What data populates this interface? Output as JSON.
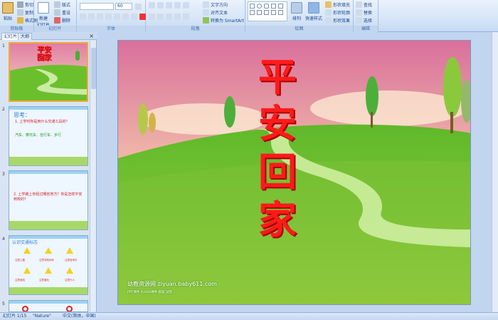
{
  "ribbon": {
    "clipboard": {
      "label": "剪贴板",
      "paste": "粘贴",
      "cut": "剪切",
      "copy": "复制",
      "format_painter": "格式刷"
    },
    "slides": {
      "label": "幻灯片",
      "new_slide": "新建\n幻灯片",
      "layout": "版式",
      "reset": "重设",
      "delete": "删除"
    },
    "font": {
      "label": "字体",
      "font_size": "60"
    },
    "paragraph": {
      "label": "段落",
      "text_direction": "文字方向",
      "align_text": "对齐文本",
      "smartart": "转换为 SmartArt"
    },
    "drawing": {
      "label": "绘图",
      "arrange": "排列",
      "quick_styles": "快速样式",
      "shape_fill": "形状填充",
      "shape_outline": "形状轮廓",
      "shape_effects": "形状效果"
    },
    "editing": {
      "label": "编辑",
      "find": "查找",
      "replace": "替换",
      "select": "选择"
    }
  },
  "panel": {
    "tab_slides": "幻灯片",
    "tab_outline": "大纲",
    "close": "×",
    "thumbs": [
      {
        "num": "1",
        "title": "平安回家"
      },
      {
        "num": "2",
        "heading": "思考：",
        "line1": "1. 上学时你是用什么交通工具的？",
        "answer": "汽车、摩托车、自行车、步行"
      },
      {
        "num": "3",
        "line1": "2. 上学路上你经过哪些地方？你是怎样平安到校的？"
      },
      {
        "num": "4",
        "heading": "认识交通标志",
        "signs": [
          "注意儿童",
          "注意非机动车",
          "注意信号灯",
          "注意危险",
          "注意落石",
          "注意行人"
        ]
      },
      {
        "num": "5"
      }
    ]
  },
  "slide": {
    "title": [
      "平",
      "安",
      "回",
      "家"
    ],
    "watermark": "幼教资源网 ziyuan.baby611.com",
    "watermark_sub": "PPT课件  FLASH课件  教案  试卷  …"
  },
  "status": {
    "slide_info": "幻灯片 1/15",
    "theme": "\"Nature\"",
    "language": "中文(简体，中国)"
  },
  "colors": {
    "title_red": "#ff1a1a",
    "selected_thumb_border": "#f2a93b"
  }
}
